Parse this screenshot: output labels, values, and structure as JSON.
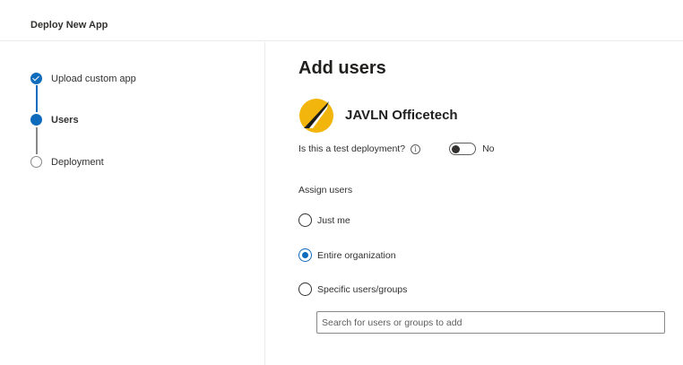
{
  "header": {
    "title": "Deploy New App"
  },
  "steps": [
    {
      "label": "Upload custom app",
      "state": "done"
    },
    {
      "label": "Users",
      "state": "current"
    },
    {
      "label": "Deployment",
      "state": "pending"
    }
  ],
  "main": {
    "title": "Add users",
    "app_name": "JAVLN Officetech",
    "test_deployment": {
      "label": "Is this a test deployment?",
      "state_label": "No",
      "value": false
    },
    "assign_label": "Assign users",
    "options": [
      {
        "label": "Just me",
        "checked": false
      },
      {
        "label": "Entire organization",
        "checked": true
      },
      {
        "label": "Specific users/groups",
        "checked": false
      }
    ],
    "search": {
      "placeholder": "Search for users or groups to add",
      "value": ""
    }
  },
  "colors": {
    "accent": "#0f6cbd",
    "logo_yellow": "#f2b50c",
    "logo_dark": "#1b1b1b"
  }
}
